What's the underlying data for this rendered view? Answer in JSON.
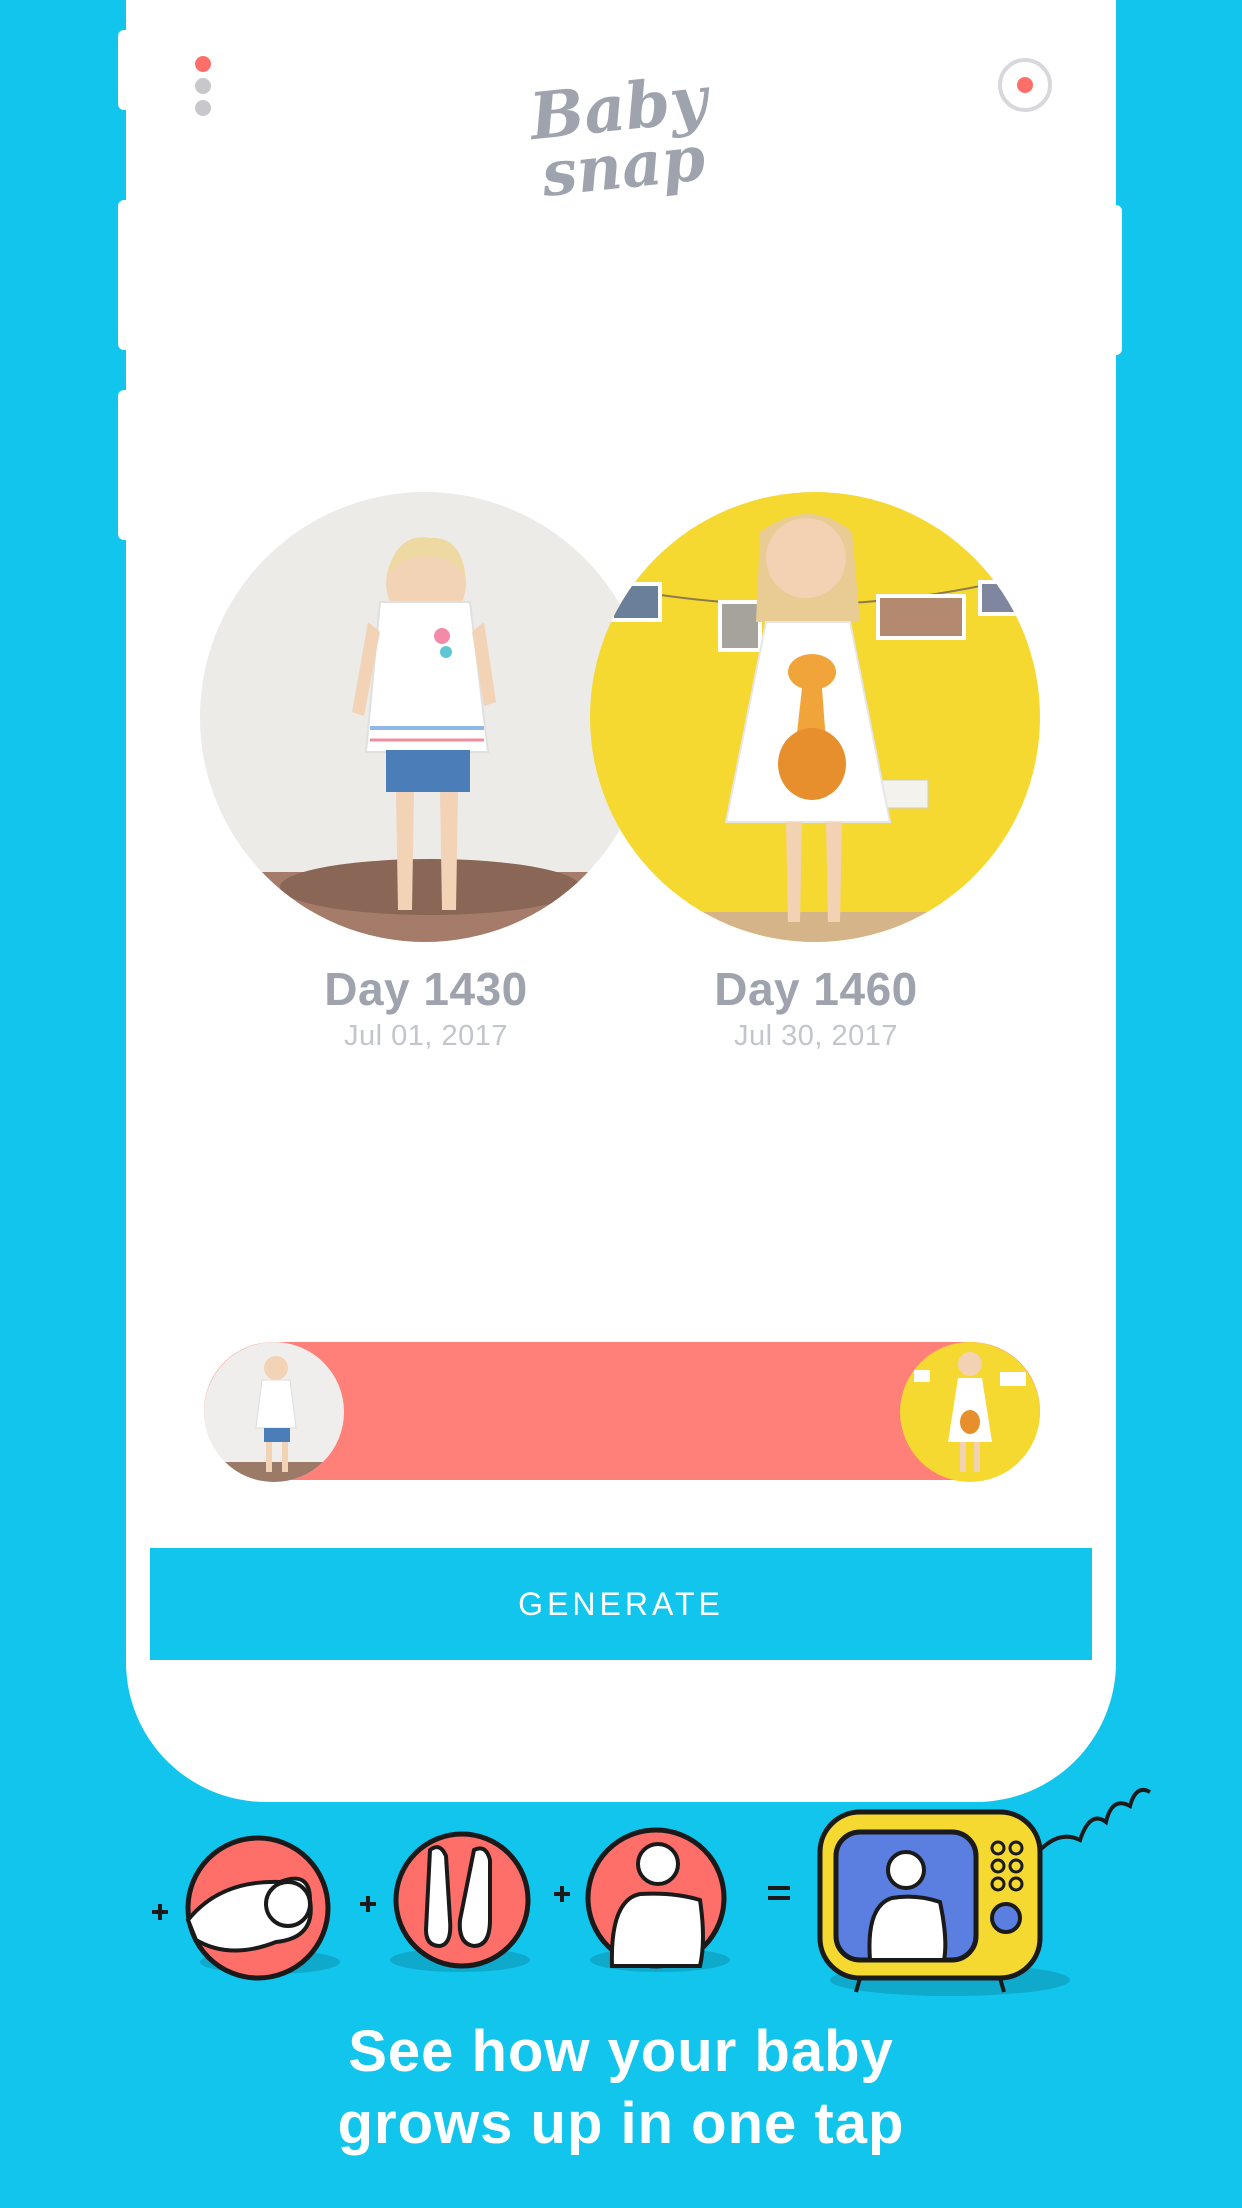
{
  "header": {
    "menu_icon": "menu-dots-icon",
    "logo_text_1": "Baby",
    "logo_text_2": "snap",
    "record_icon": "record-icon"
  },
  "photos": [
    {
      "day": "Day 1430",
      "date": "Jul 01, 2017"
    },
    {
      "day": "Day 1460",
      "date": "Jul 30, 2017"
    }
  ],
  "slider": {
    "start_thumb": "first-photo-thumbnail",
    "end_thumb": "last-photo-thumbnail"
  },
  "actions": {
    "generate_label": "GENERATE"
  },
  "promo": {
    "tagline_line1": "See how your baby",
    "tagline_line2": "grows up in one tap"
  },
  "colors": {
    "background": "#12C5EC",
    "accent": "#FF7F79",
    "yellow": "#F5D830",
    "text_gray": "#9ea3ad"
  }
}
